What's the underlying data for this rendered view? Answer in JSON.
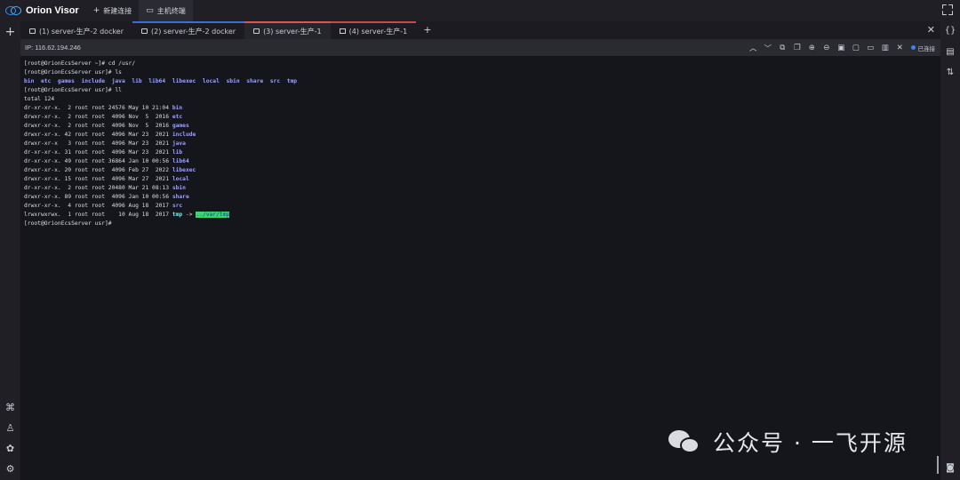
{
  "app": {
    "name": "Orion Visor"
  },
  "top_tabs": [
    {
      "label": "新建连接",
      "icon": "plus-icon"
    },
    {
      "label": "主机终端",
      "icon": "monitor-icon"
    }
  ],
  "session_tabs": [
    {
      "label": "(1) server-生产-2 docker"
    },
    {
      "label": "(2) server-生产-2 docker"
    },
    {
      "label": "(3) server-生产-1"
    },
    {
      "label": "(4) server-生产-1"
    }
  ],
  "terminal_header": {
    "ip": "IP: 116.62.194.246",
    "status": "已连接"
  },
  "terminal_lines": [
    "[root@OrionEcsServer ~]# cd /usr/",
    "[root@OrionEcsServer usr]# ls",
    "bin  etc  games  include  java  lib  lib64  libexec  local  sbin  share  src  tmp",
    "[root@OrionEcsServer usr]# ll",
    "total 124",
    "dr-xr-xr-x.  2 root root 24576 May 10 21:04 bin",
    "drwxr-xr-x.  2 root root  4096 Nov  5  2016 etc",
    "drwxr-xr-x.  2 root root  4096 Nov  5  2016 games",
    "drwxr-xr-x. 42 root root  4096 Mar 23  2021 include",
    "drwxr-xr-x   3 root root  4096 Mar 23  2021 java",
    "dr-xr-xr-x. 31 root root  4096 Mar 23  2021 lib",
    "dr-xr-xr-x. 49 root root 36864 Jan 10 00:56 lib64",
    "drwxr-xr-x. 20 root root  4096 Feb 27  2022 libexec",
    "drwxr-xr-x. 15 root root  4096 Mar 27  2021 local",
    "dr-xr-xr-x.  2 root root 20480 Mar 21 08:13 sbin",
    "drwxr-xr-x. 89 root root  4096 Jan 10 00:56 share",
    "drwxr-xr-x.  4 root root  4096 Aug 18  2017 src",
    "lrwxrwxrwx.  1 root root    10 Aug 18  2017 tmp -> ../var/tmp",
    "[root@OrionEcsServer usr]#"
  ],
  "watermark": {
    "text": "公众号 · 一飞开源"
  },
  "colors": {
    "accent": "#3b82f6",
    "tab_active": "#e05353",
    "dir": "#9aa0ff",
    "link": "#7ee7f0",
    "link_target_bg": "#3cd66e"
  }
}
